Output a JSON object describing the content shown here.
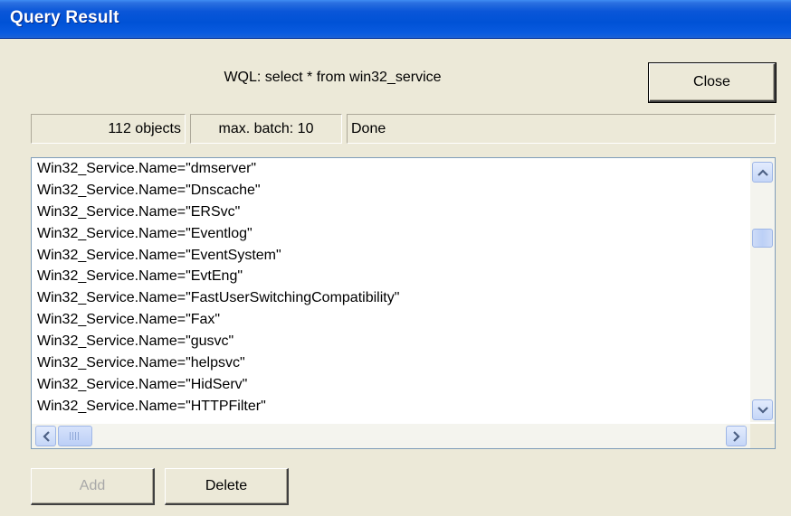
{
  "window": {
    "title": "Query Result"
  },
  "query": {
    "wql": "WQL: select * from win32_service"
  },
  "buttons": {
    "close": "Close",
    "add": "Add",
    "delete": "Delete"
  },
  "status": {
    "objects": "112 objects",
    "batch": "max. batch: 10",
    "state": "Done"
  },
  "results": [
    "Win32_Service.Name=\"dmserver\"",
    "Win32_Service.Name=\"Dnscache\"",
    "Win32_Service.Name=\"ERSvc\"",
    "Win32_Service.Name=\"Eventlog\"",
    "Win32_Service.Name=\"EventSystem\"",
    "Win32_Service.Name=\"EvtEng\"",
    "Win32_Service.Name=\"FastUserSwitchingCompatibility\"",
    "Win32_Service.Name=\"Fax\"",
    "Win32_Service.Name=\"gusvc\"",
    "Win32_Service.Name=\"helpsvc\"",
    "Win32_Service.Name=\"HidServ\"",
    "Win32_Service.Name=\"HTTPFilter\""
  ],
  "icons": {
    "scroll_up": "chevron-up-icon",
    "scroll_down": "chevron-down-icon",
    "scroll_left": "chevron-left-icon",
    "scroll_right": "chevron-right-icon"
  },
  "colors": {
    "titlebar": "#0052d6",
    "face": "#ece9d8",
    "list_border": "#7f9db9",
    "disabled_text": "#a8a8a8"
  }
}
